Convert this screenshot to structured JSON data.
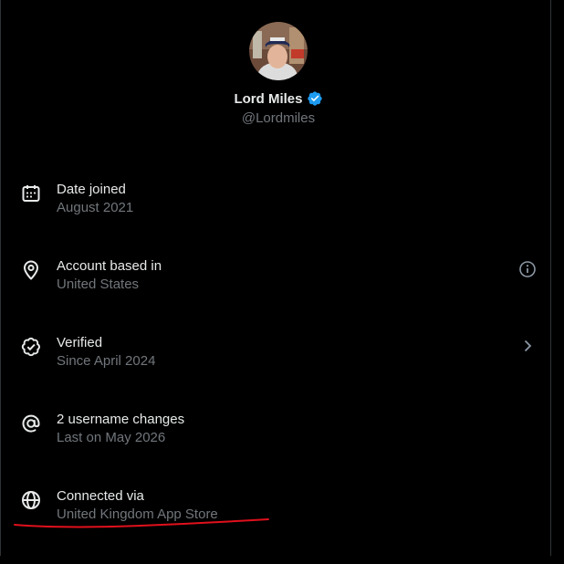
{
  "profile": {
    "name": "Lord Miles",
    "handle": "@Lordmiles",
    "verified_color": "#1d9bf0"
  },
  "rows": [
    {
      "icon": "calendar-icon",
      "title": "Date joined",
      "subtitle": "August 2021",
      "action": ""
    },
    {
      "icon": "location-pin-icon",
      "title": "Account based in",
      "subtitle": "United States",
      "action": "info-icon"
    },
    {
      "icon": "verified-badge-outline-icon",
      "title": "Verified",
      "subtitle": "Since April 2024",
      "action": "chevron-right-icon"
    },
    {
      "icon": "at-sign-icon",
      "title": "2 username changes",
      "subtitle": "Last on May 2026",
      "action": ""
    },
    {
      "icon": "globe-icon",
      "title": "Connected via",
      "subtitle": "United Kingdom App Store",
      "action": ""
    }
  ],
  "colors": {
    "background": "#000000",
    "primary_text": "#e7e9ea",
    "secondary_text": "#71767b",
    "annotation": "#e0101c"
  }
}
